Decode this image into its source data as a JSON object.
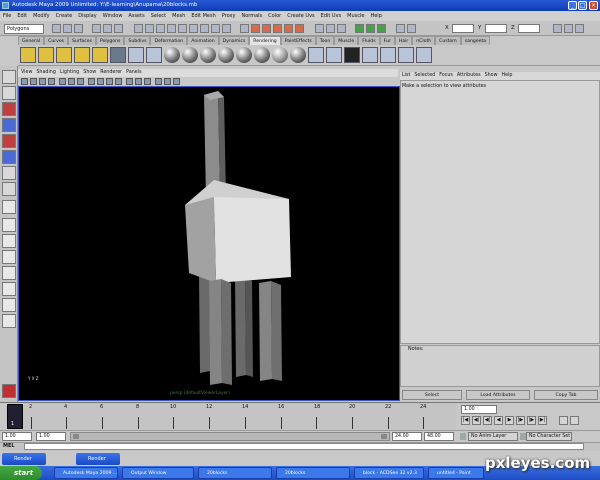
{
  "window": {
    "title": "Autodesk Maya 2009 Unlimited: Y:\\E-learning\\Anupama\\20blocks.mb"
  },
  "menubar": [
    "File",
    "Edit",
    "Modify",
    "Create",
    "Display",
    "Window",
    "Assets",
    "Select",
    "Mesh",
    "Edit Mesh",
    "Proxy",
    "Normals",
    "Color",
    "Create Uvs",
    "Edit Uvs",
    "Muscle",
    "Help"
  ],
  "status_line": {
    "menu_set": "Polygons",
    "x_label": "X",
    "y_label": "Y",
    "z_label": "Z"
  },
  "shelf_tabs": [
    "General",
    "Curves",
    "Surfaces",
    "Polygons",
    "Subdivs",
    "Deformation",
    "Animation",
    "Dynamics",
    "Rendering",
    "PaintEffects",
    "Toon",
    "Muscle",
    "Fluids",
    "Fur",
    "Hair",
    "nCloth",
    "Custom",
    "sangeeta"
  ],
  "shelf_active_tab": "Rendering",
  "panel_menu": [
    "View",
    "Shading",
    "Lighting",
    "Show",
    "Renderer",
    "Panels"
  ],
  "viewport": {
    "camera_label": "persp (defaultViewerLayer)",
    "axis_label": "Y X Z",
    "background": "#000000",
    "object_color": "#8a8a8a"
  },
  "attribute_editor": {
    "menu": [
      "List",
      "Selected",
      "Focus",
      "Attributes",
      "Show",
      "Help"
    ],
    "message": "Make a selection to view attributes",
    "notes_label": "Notes:",
    "buttons": [
      "Select",
      "Load Attributes",
      "Copy Tab"
    ]
  },
  "timeline": {
    "ticks": [
      "2",
      "4",
      "6",
      "8",
      "10",
      "12",
      "14",
      "16",
      "18",
      "20",
      "22",
      "24"
    ],
    "current_frame": "1",
    "current_field": "1.00"
  },
  "range": {
    "start": "1.00",
    "start2": "1.00",
    "end": "24.00",
    "end2": "48.00",
    "anim_layer": "No Anim Layer",
    "character_set": "No Character Set"
  },
  "command_line": {
    "label": "MEL"
  },
  "mini_windows": [
    "Render",
    "Render"
  ],
  "start_label": "start",
  "taskbar_items": [
    "Autodesk Maya 2009 ...",
    "Output Window",
    "20blocks",
    "20blocks",
    "block - ACDSee 32 v2.3",
    "untitled - Paint"
  ],
  "watermark": "pxleyes.com"
}
